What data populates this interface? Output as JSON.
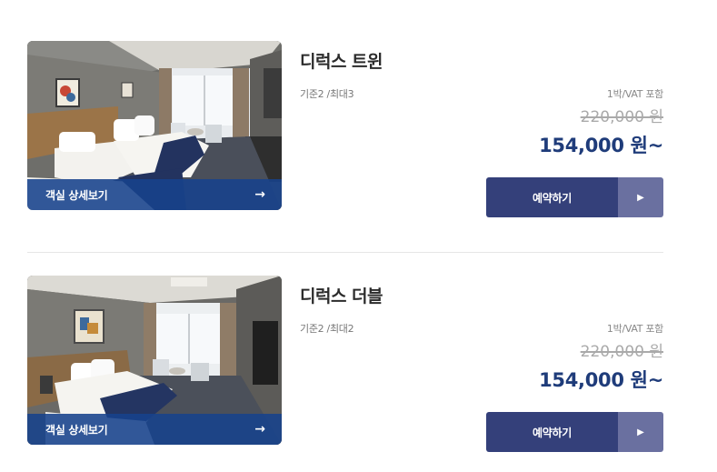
{
  "rooms": [
    {
      "name": "디럭스 트윈",
      "capacity": "기준2 /최대3",
      "vat_note": "1박/VAT 포함",
      "original_price": "220,000 원",
      "sale_price": "154,000 원~",
      "detail_label": "객실 상세보기",
      "detail_arrow": "→",
      "reserve_label": "예약하기",
      "reserve_arrow": "▶",
      "photo_icon": "room-photo-twin"
    },
    {
      "name": "디럭스 더블",
      "capacity": "기준2 /최대2",
      "vat_note": "1박/VAT 포함",
      "original_price": "220,000 원",
      "sale_price": "154,000 원~",
      "detail_label": "객실 상세보기",
      "detail_arrow": "→",
      "reserve_label": "예약하기",
      "reserve_arrow": "▶",
      "photo_icon": "room-photo-double"
    }
  ],
  "colors": {
    "price": "#1f3c7a",
    "button": "#34407a",
    "button_side": "#6a70a0",
    "detail_bar": "#17428c"
  }
}
